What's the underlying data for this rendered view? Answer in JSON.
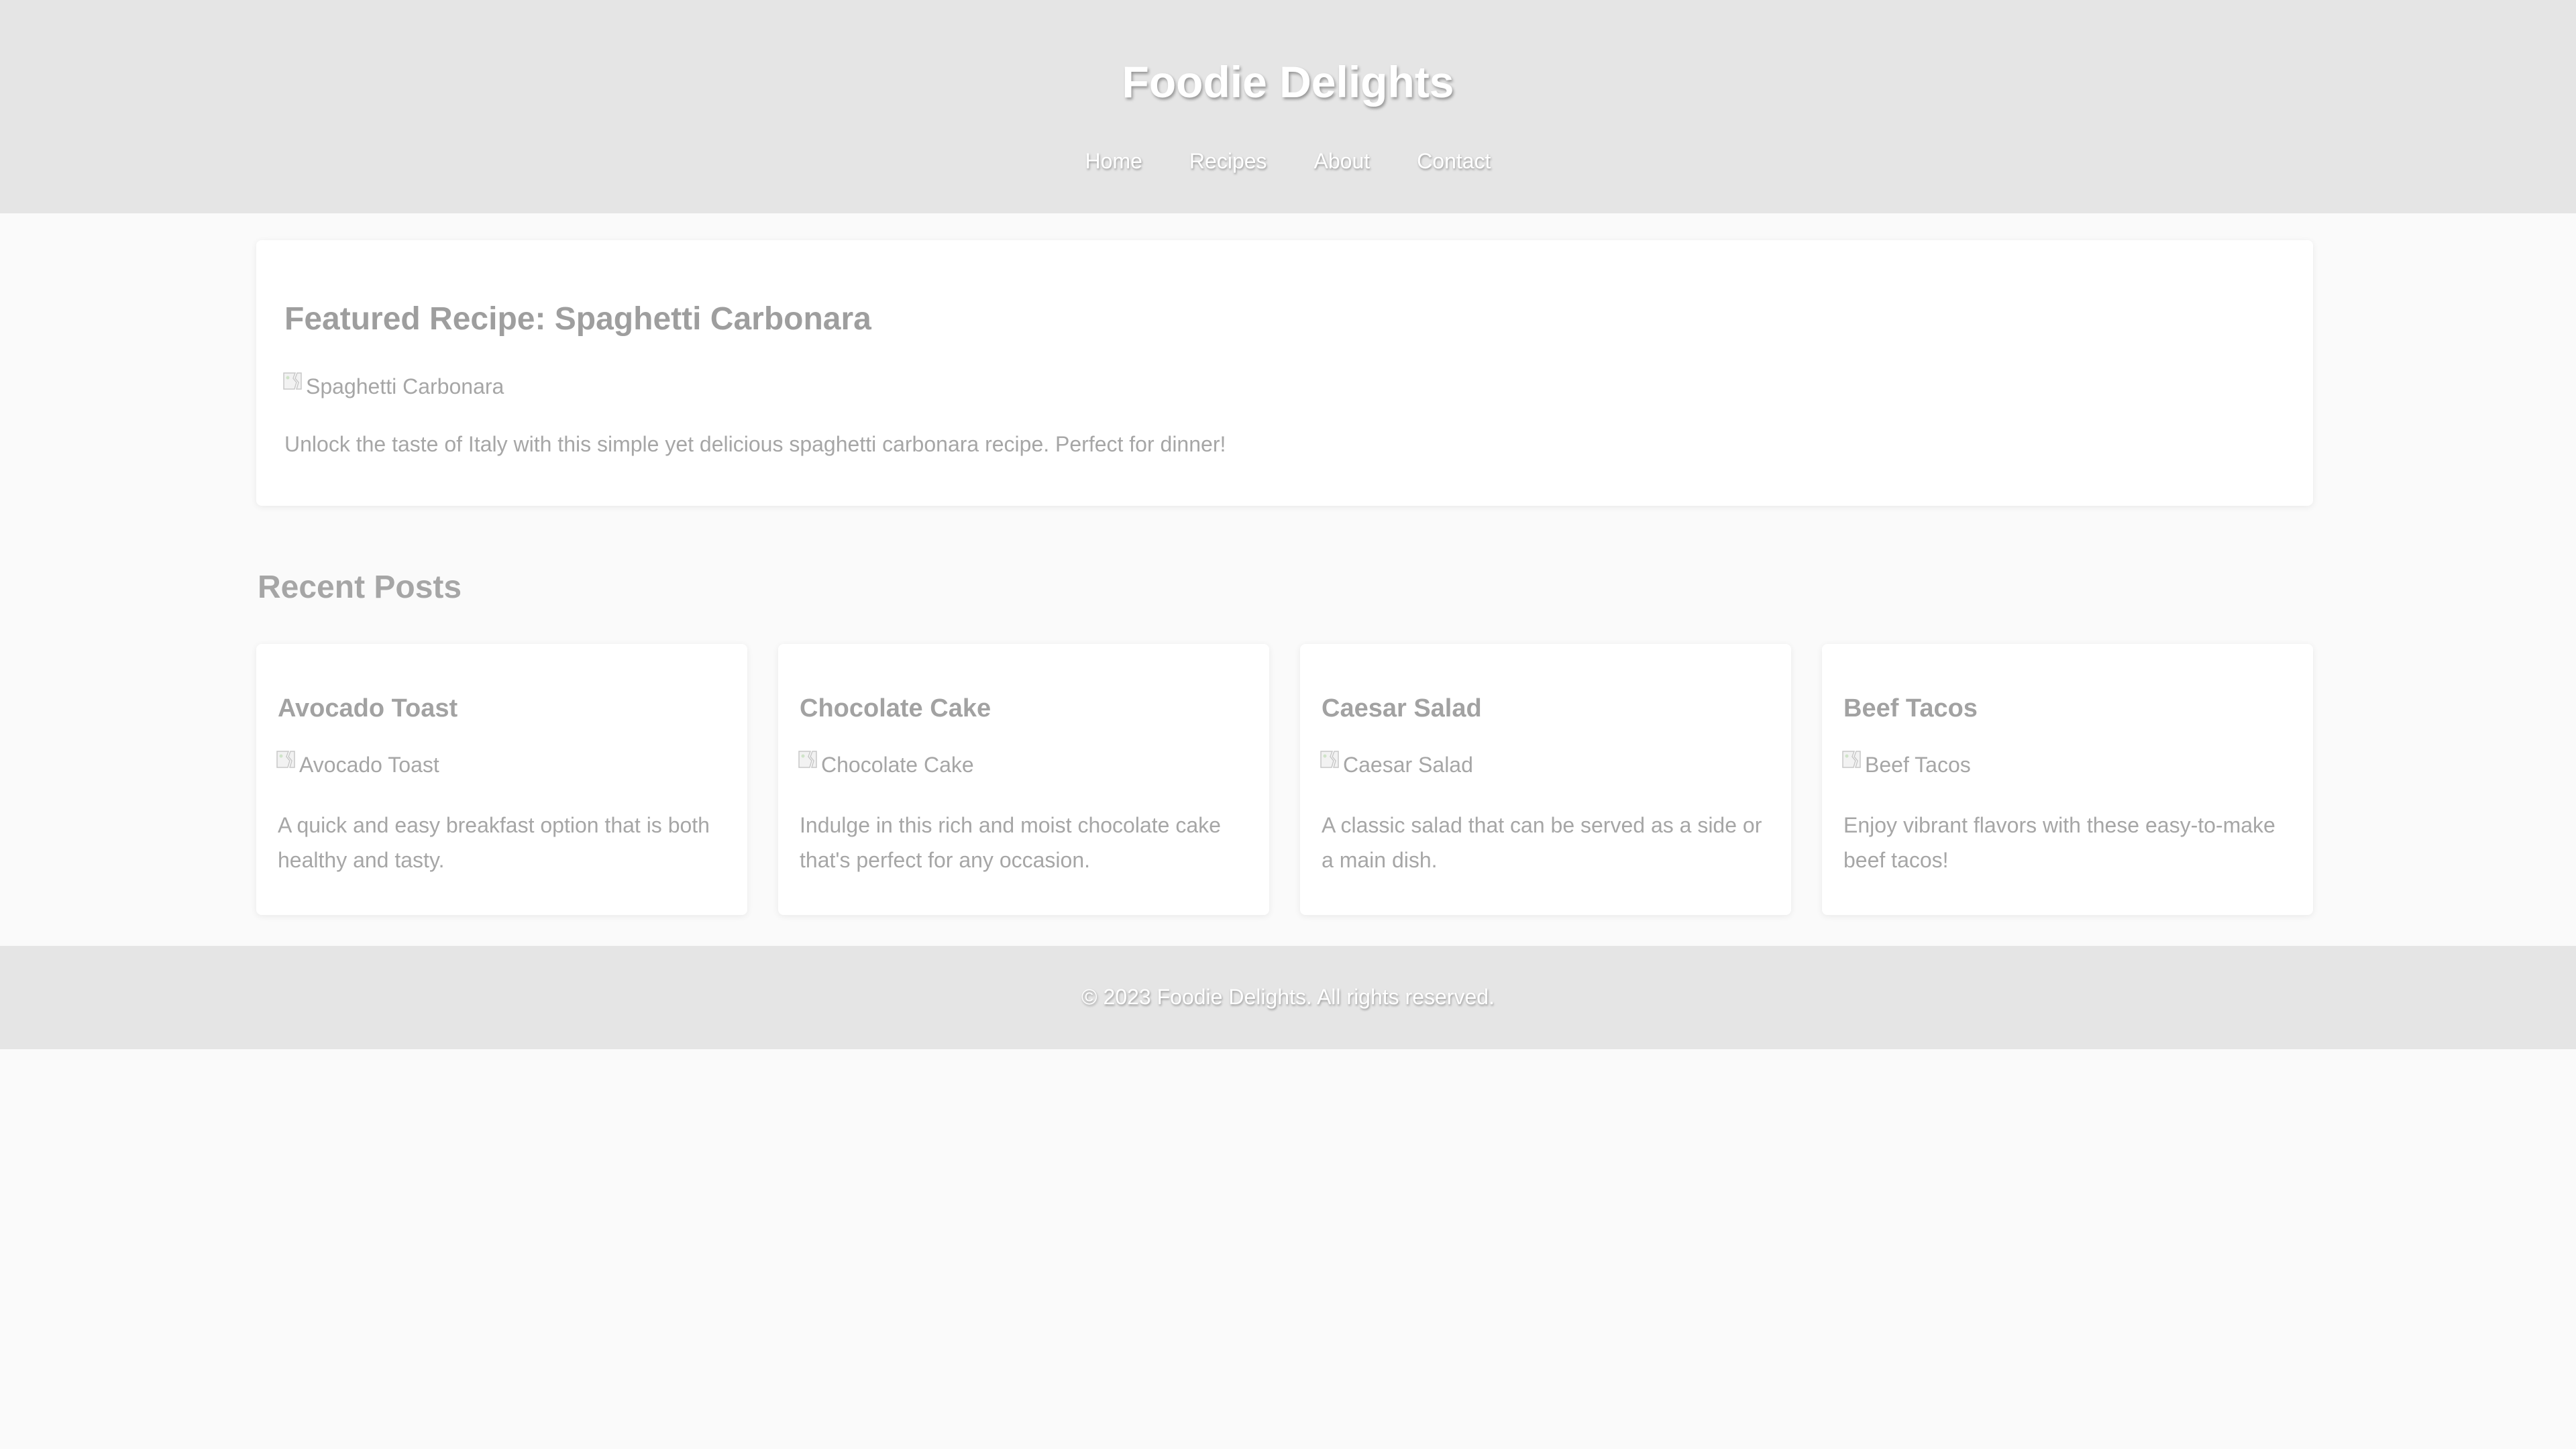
{
  "header": {
    "title": "Foodie Delights",
    "nav": [
      {
        "label": "Home"
      },
      {
        "label": "Recipes"
      },
      {
        "label": "About"
      },
      {
        "label": "Contact"
      }
    ]
  },
  "featured": {
    "title": "Featured Recipe: Spaghetti Carbonara",
    "image_alt": "Spaghetti Carbonara",
    "description": "Unlock the taste of Italy with this simple yet delicious spaghetti carbonara recipe. Perfect for dinner!"
  },
  "recent": {
    "title": "Recent Posts",
    "posts": [
      {
        "title": "Avocado Toast",
        "image_alt": "Avocado Toast",
        "description": "A quick and easy breakfast option that is both healthy and tasty."
      },
      {
        "title": "Chocolate Cake",
        "image_alt": "Chocolate Cake",
        "description": "Indulge in this rich and moist chocolate cake that's perfect for any occasion."
      },
      {
        "title": "Caesar Salad",
        "image_alt": "Caesar Salad",
        "description": "A classic salad that can be served as a side or a main dish."
      },
      {
        "title": "Beef Tacos",
        "image_alt": "Beef Tacos",
        "description": "Enjoy vibrant flavors with these easy-to-make beef tacos!"
      }
    ]
  },
  "footer": {
    "text": "© 2023 Foodie Delights. All rights reserved."
  },
  "icons": {
    "broken_image": "broken-image-icon"
  },
  "colors": {
    "header_bg": "#e5e5e5",
    "page_bg": "#fafafa",
    "card_bg": "#ffffff"
  }
}
